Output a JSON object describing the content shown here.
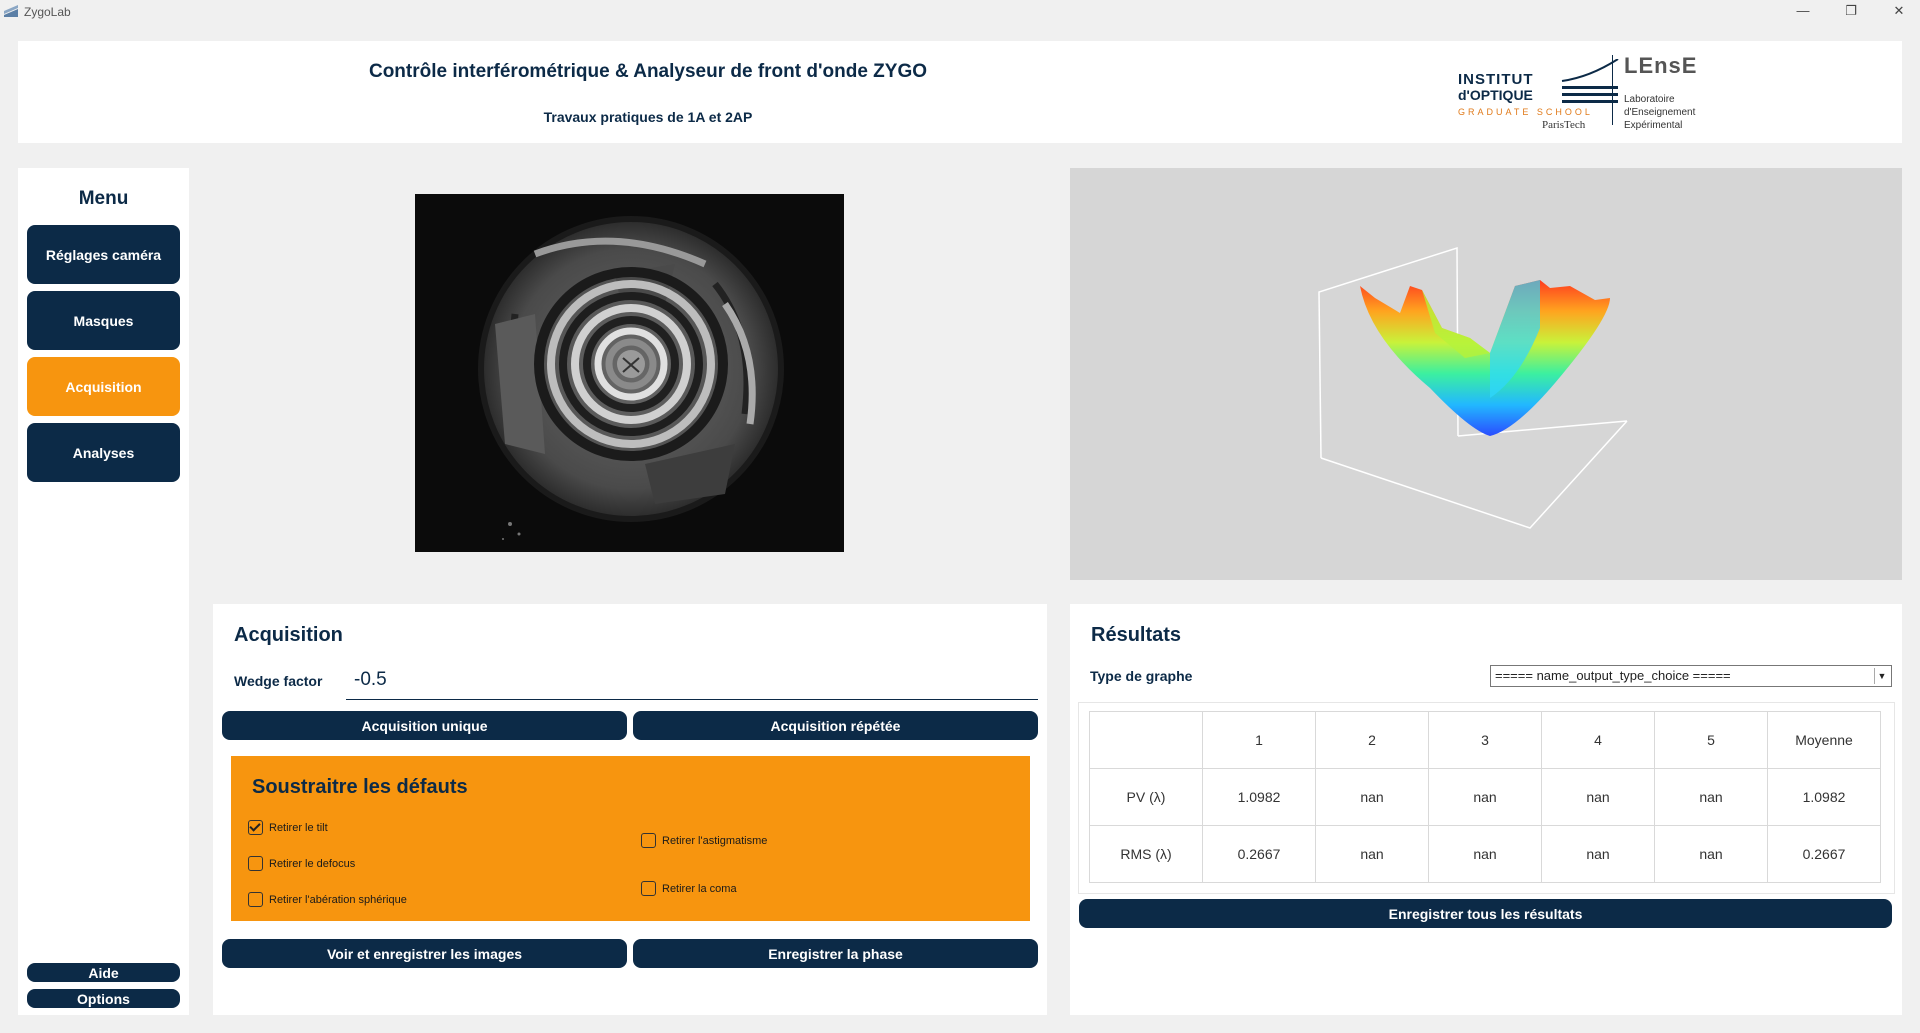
{
  "window": {
    "title": "ZygoLab",
    "controls": {
      "minimize": "—",
      "restore": "❐",
      "close": "✕"
    }
  },
  "header": {
    "title": "Contrôle interférométrique & Analyseur de front d'onde ZYGO",
    "subtitle": "Travaux pratiques de 1A et 2AP",
    "logo_iogs": {
      "line1": "INSTITUT",
      "line2": "d'OPTIQUE",
      "line3": "GRADUATE SCHOOL",
      "line4": "ParisTech"
    },
    "logo_lense": {
      "name": "LEnsE",
      "line1": "Laboratoire",
      "line2": "d'Enseignement",
      "line3": "Expérimental"
    }
  },
  "sidebar": {
    "title": "Menu",
    "items": [
      {
        "label": "Réglages caméra",
        "active": false
      },
      {
        "label": "Masques",
        "active": false
      },
      {
        "label": "Acquisition",
        "active": true
      },
      {
        "label": "Analyses",
        "active": false
      }
    ],
    "help_label": "Aide",
    "options_label": "Options"
  },
  "acquisition": {
    "title": "Acquisition",
    "wedge_label": "Wedge factor",
    "wedge_value": "-0.5",
    "single_button": "Acquisition unique",
    "repeated_button": "Acquisition répétée",
    "defects": {
      "title": "Soustraitre les défauts",
      "options": [
        {
          "label": "Retirer le tilt",
          "checked": true
        },
        {
          "label": "Retirer le defocus",
          "checked": false
        },
        {
          "label": "Retirer l'abération sphérique",
          "checked": false
        },
        {
          "label": "Retirer l'astigmatisme",
          "checked": false
        },
        {
          "label": "Retirer la coma",
          "checked": false
        }
      ]
    },
    "view_save_images_button": "Voir et enregistrer les images",
    "save_phase_button": "Enregistrer la phase"
  },
  "results": {
    "title": "Résultats",
    "graph_type_label": "Type de graphe",
    "graph_type_value": "===== name_output_type_choice =====",
    "table": {
      "headers": [
        "",
        "1",
        "2",
        "3",
        "4",
        "5",
        "Moyenne"
      ],
      "rows": [
        [
          "PV (λ)",
          "1.0982",
          "nan",
          "nan",
          "nan",
          "nan",
          "1.0982"
        ],
        [
          "RMS (λ)",
          "0.2667",
          "nan",
          "nan",
          "nan",
          "nan",
          "0.2667"
        ]
      ]
    },
    "save_all_button": "Enregistrer tous les résultats"
  },
  "colors": {
    "navy": "#0c2a47",
    "orange": "#f7950f",
    "background": "#f0f0f0"
  }
}
